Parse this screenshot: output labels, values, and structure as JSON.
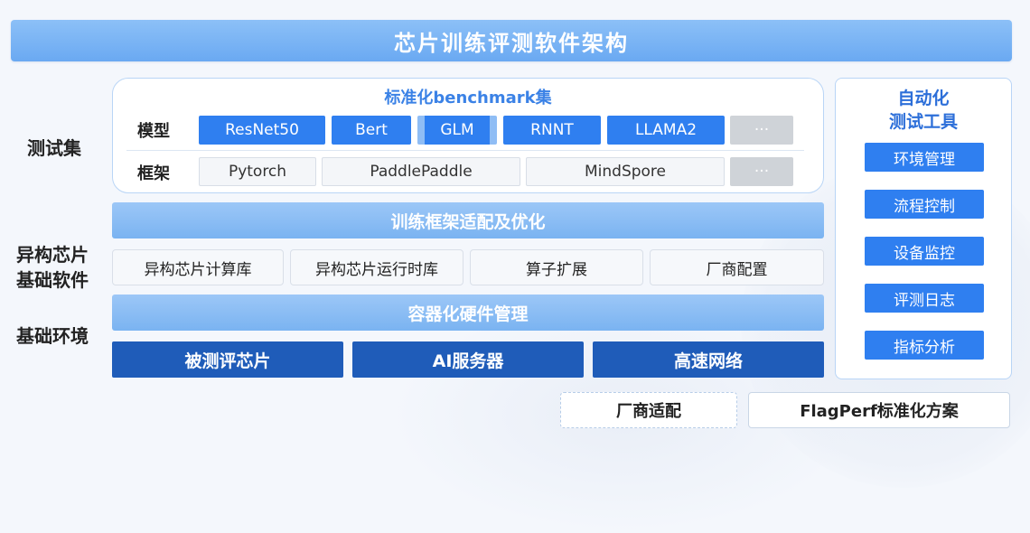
{
  "title": "芯片训练评测软件架构",
  "side_labels": {
    "test_set": "测试集",
    "hetero_line1": "异构芯片",
    "hetero_line2": "基础软件",
    "base_env": "基础环境"
  },
  "benchmark": {
    "title": "标准化benchmark集",
    "model_label": "模型",
    "framework_label": "框架",
    "models": [
      "ResNet50",
      "Bert",
      "GLM",
      "RNNT",
      "LLAMA2",
      "···"
    ],
    "frameworks": [
      "Pytorch",
      "PaddlePaddle",
      "MindSpore",
      "···"
    ]
  },
  "optimize_band": "训练框架适配及优化",
  "hetero_items": [
    "异构芯片计算库",
    "异构芯片运行时库",
    "算子扩展",
    "厂商配置"
  ],
  "container_band": "容器化硬件管理",
  "base_items": [
    "被测评芯片",
    "AI服务器",
    "高速网络"
  ],
  "auto_tools": {
    "title_line1": "自动化",
    "title_line2": "测试工具",
    "items": [
      "环境管理",
      "流程控制",
      "设备监控",
      "评测日志",
      "指标分析"
    ]
  },
  "footer": {
    "vendor": "厂商适配",
    "flagperf": "FlagPerf标准化方案"
  },
  "colors": {
    "primary": "#2f7ff0",
    "title_bar": "#7ab3f1",
    "dark": "#1f5cb9",
    "accent_text": "#3b82e6"
  }
}
